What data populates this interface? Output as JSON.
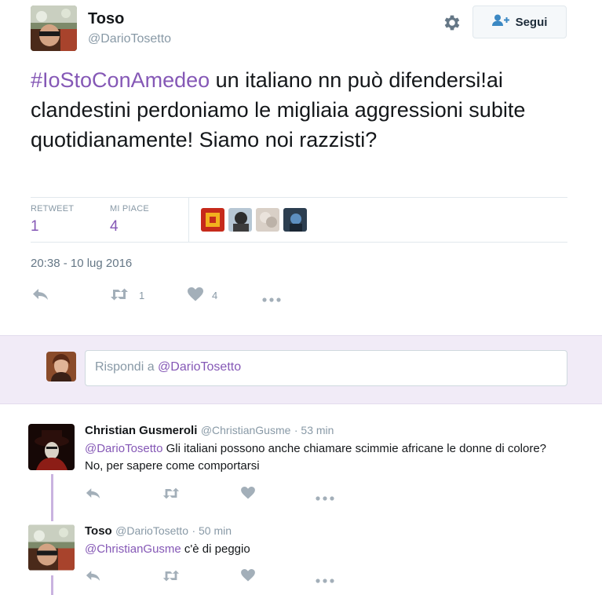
{
  "tweet": {
    "author_name": "Toso",
    "author_handle": "@DarioTosetto",
    "follow_label": "Segui",
    "hashtag": "#IoStoConAmedeo",
    "text_rest": " un italiano nn può difendersi!ai clandestini perdoniamo le migliaia aggressioni subite quotidianamente! Siamo noi razzisti?",
    "retweet_label": "RETWEET",
    "retweet_count": "1",
    "likes_label": "MI PIACE",
    "likes_count": "4",
    "timestamp": "20:38 - 10 lug 2016",
    "action_retweet_count": "1",
    "action_like_count": "4"
  },
  "reply_box": {
    "prefix": "Rispondi a ",
    "mention": "@DarioTosetto"
  },
  "replies": [
    {
      "name": "Christian Gusmeroli",
      "handle": "@ChristianGusme",
      "time": "· 53 min",
      "mention": "@DarioTosetto",
      "text": " Gli italiani possono anche chiamare scimmie africane le donne di colore? No, per sapere come comportarsi"
    },
    {
      "name": "Toso",
      "handle": "@DarioTosetto",
      "time": "· 50 min",
      "mention": "@ChristianGusme",
      "text": " c'è di peggio"
    }
  ],
  "colors": {
    "accent": "#8558b6",
    "muted": "#8899a6",
    "reply_band": "#f1ebf7"
  }
}
